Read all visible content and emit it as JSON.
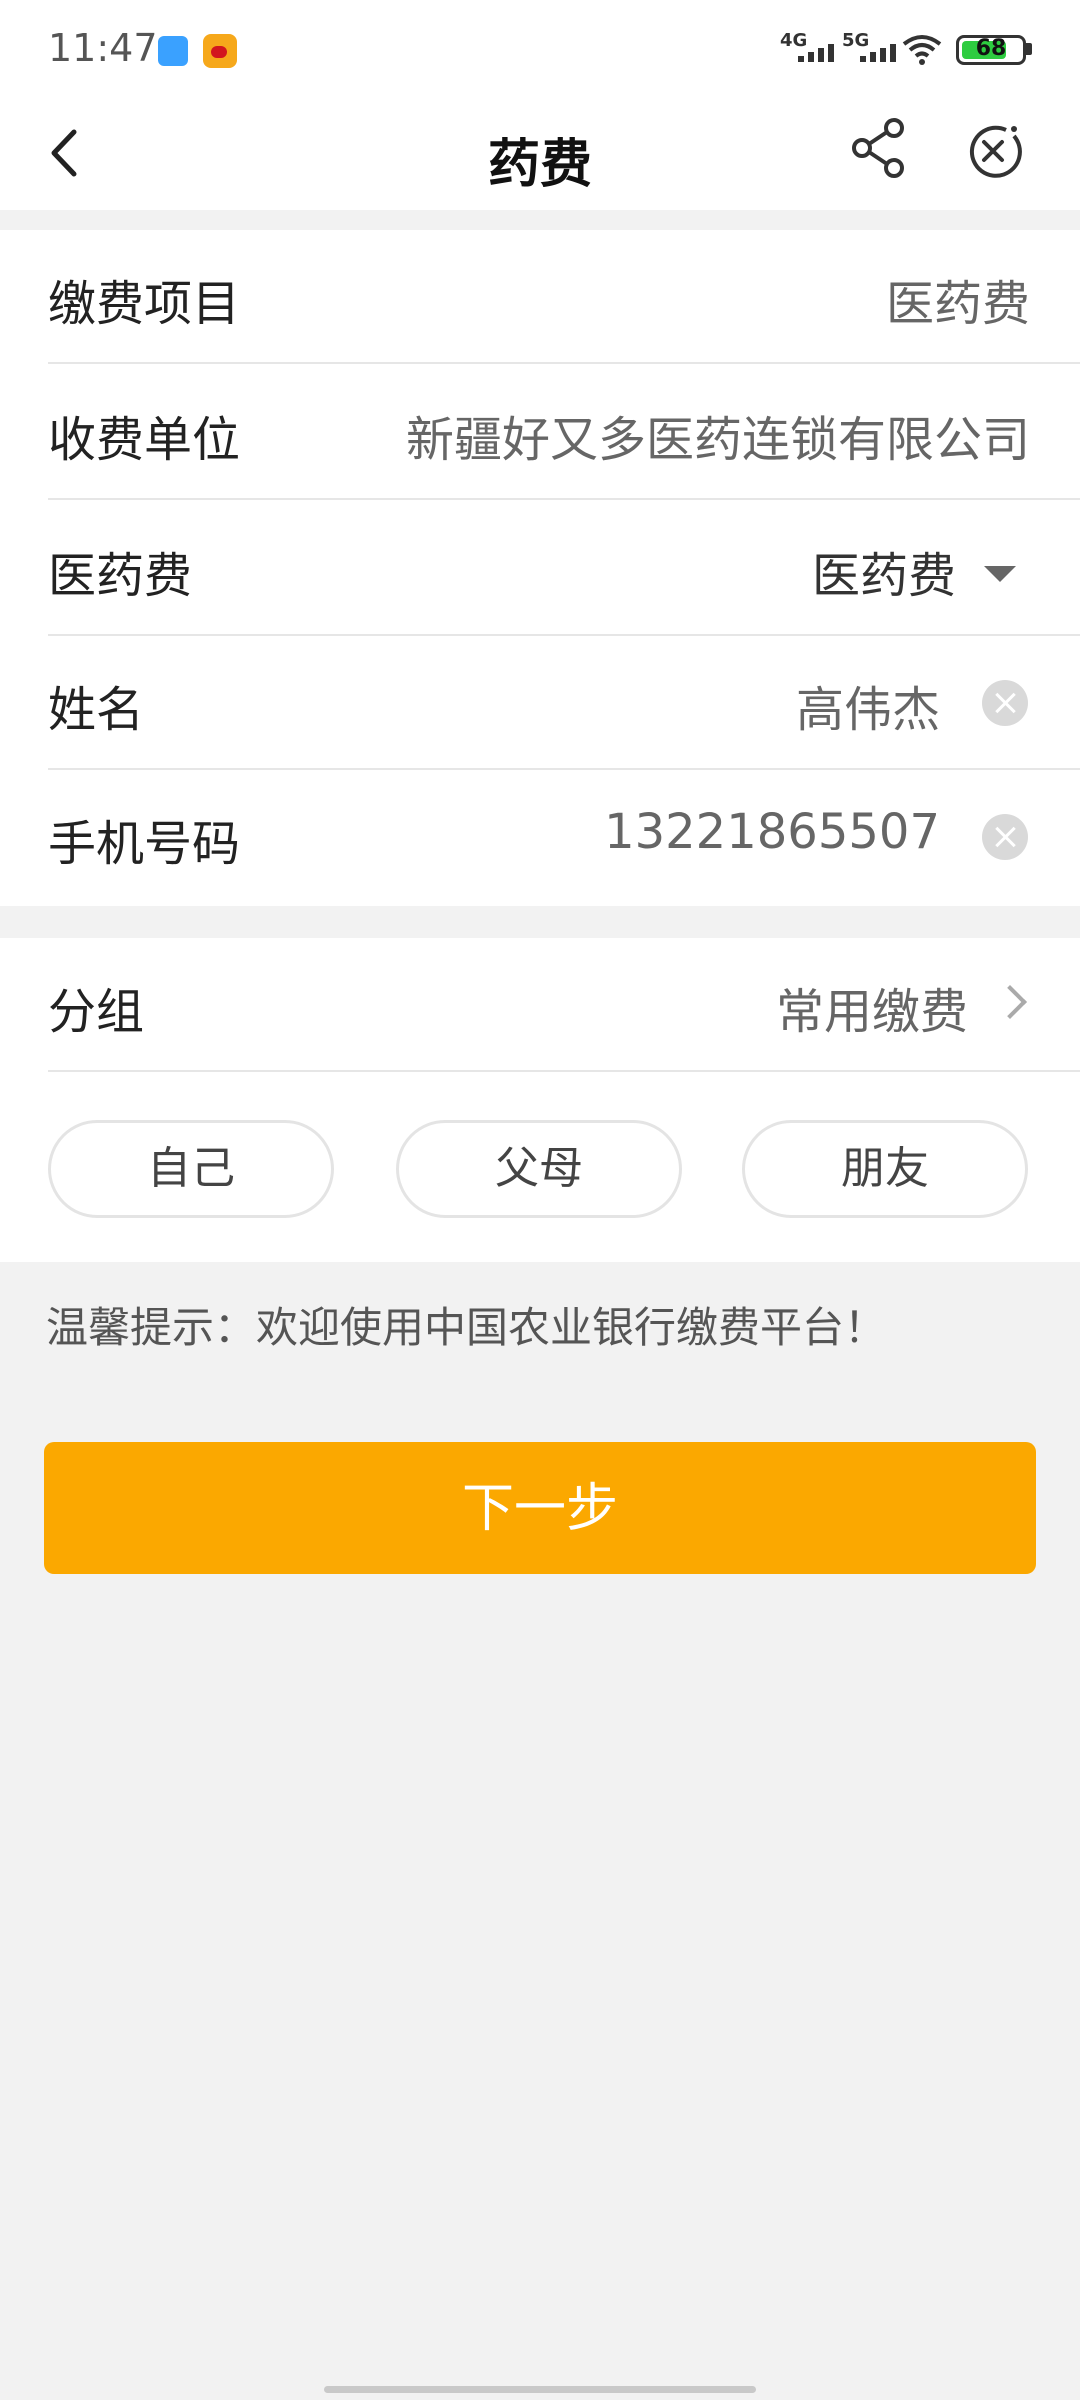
{
  "status_bar": {
    "time": "11:47",
    "network_1": "4G",
    "network_2": "5G",
    "battery": "68"
  },
  "nav": {
    "title": "药费"
  },
  "form": {
    "rows": [
      {
        "label": "缴费项目",
        "value": "医药费"
      },
      {
        "label": "收费单位",
        "value": "新疆好又多医药连锁有限公司"
      },
      {
        "label": "医药费",
        "value": "医药费"
      },
      {
        "label": "姓名",
        "value": "高伟杰"
      },
      {
        "label": "手机号码",
        "value": "13221865507"
      }
    ]
  },
  "group": {
    "label": "分组",
    "value": "常用缴费",
    "chips": [
      "自己",
      "父母",
      "朋友"
    ]
  },
  "tip": "温馨提示：欢迎使用中国农业银行缴费平台！",
  "next_button": "下一步",
  "colors": {
    "accent": "#fba800",
    "background": "#f2f2f2"
  }
}
